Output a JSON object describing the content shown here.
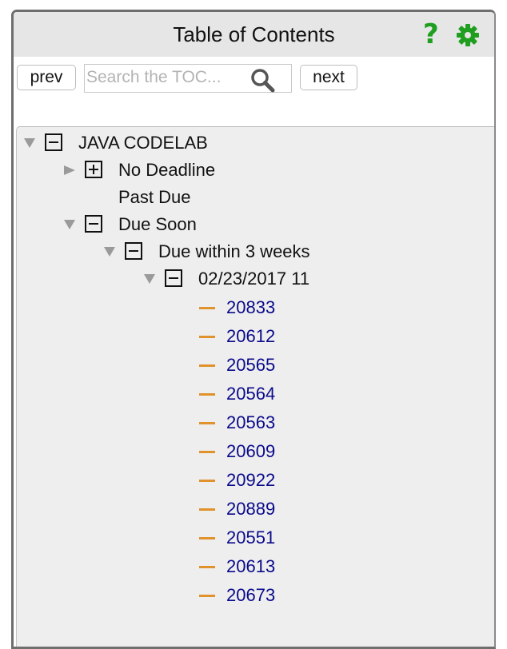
{
  "panel": {
    "title": "Table of Contents",
    "help_icon": "question-mark-icon",
    "settings_icon": "gear-icon",
    "colors": {
      "icon_green": "#1f9e1f",
      "link_blue": "#0a0a8c",
      "dash_orange": "#e0932c"
    }
  },
  "toolbar": {
    "prev_label": "prev",
    "next_label": "next",
    "search_placeholder": "Search the TOC...",
    "search_value": ""
  },
  "tree": {
    "root": {
      "label": "JAVA CODELAB",
      "state": "expanded"
    },
    "no_deadline": {
      "label": "No Deadline",
      "state": "collapsed"
    },
    "past_due": {
      "label": "Past Due"
    },
    "due_soon": {
      "label": "Due Soon",
      "state": "expanded"
    },
    "due_within": {
      "label": "Due within 3 weeks",
      "state": "expanded"
    },
    "date_group": {
      "label": "02/23/2017 11",
      "state": "expanded"
    },
    "items": [
      "20833",
      "20612",
      "20565",
      "20564",
      "20563",
      "20609",
      "20922",
      "20889",
      "20551",
      "20613",
      "20673"
    ]
  }
}
